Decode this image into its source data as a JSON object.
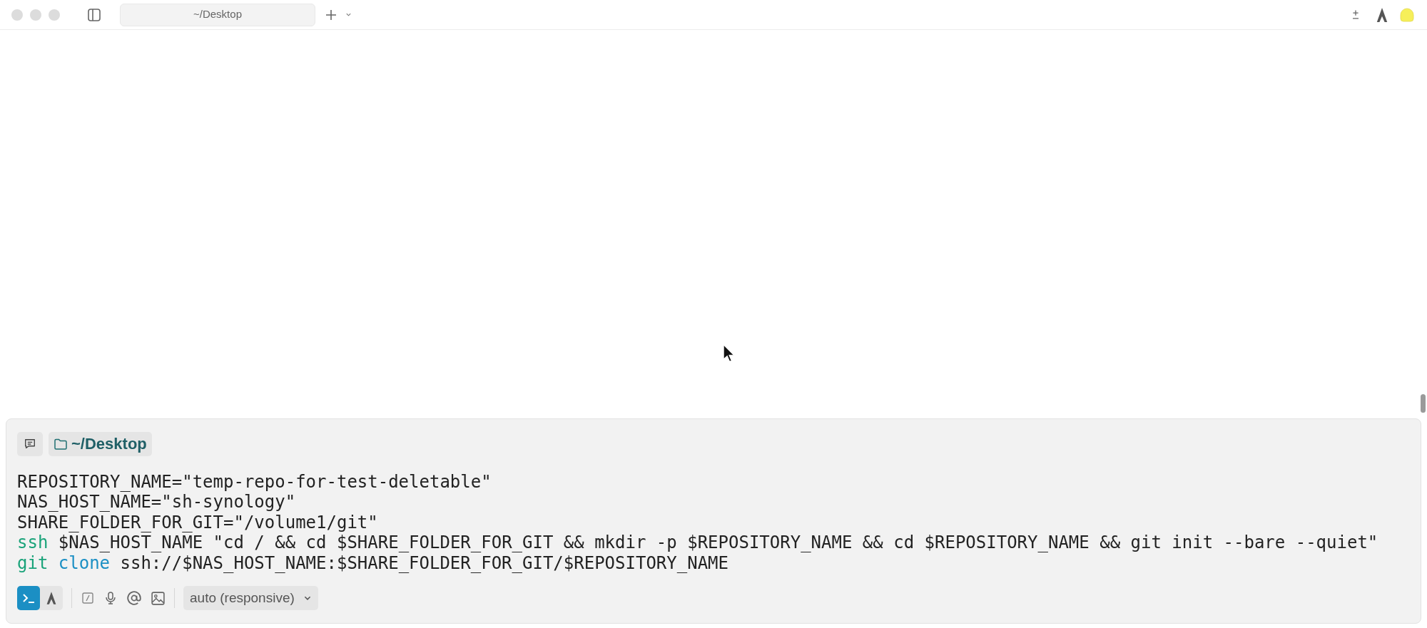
{
  "tab": {
    "title": "~/Desktop",
    "selected": true
  },
  "input": {
    "directory": "~/Desktop",
    "lines": [
      [
        {
          "kind": "plain",
          "text": "REPOSITORY_NAME=\"temp-repo-for-test-deletable\""
        }
      ],
      [
        {
          "kind": "plain",
          "text": "NAS_HOST_NAME=\"sh-synology\""
        }
      ],
      [
        {
          "kind": "plain",
          "text": "SHARE_FOLDER_FOR_GIT=\"/volume1/git\""
        }
      ],
      [
        {
          "kind": "command",
          "text": "ssh"
        },
        {
          "kind": "plain",
          "text": " $NAS_HOST_NAME \"cd / && cd $SHARE_FOLDER_FOR_GIT && mkdir -p $REPOSITORY_NAME && cd $REPOSITORY_NAME && git init --bare --quiet\""
        }
      ],
      [
        {
          "kind": "command",
          "text": "git"
        },
        {
          "kind": "subcommand",
          "text": "clone"
        },
        {
          "kind": "plain",
          "text": " ssh://$NAS_HOST_NAME:$SHARE_FOLDER_FOR_GIT/$REPOSITORY_NAME"
        }
      ]
    ],
    "modes": [
      {
        "kind": "terminal",
        "selected": true
      },
      {
        "kind": "agent",
        "selected": false
      }
    ],
    "model": "auto (responsive)"
  }
}
